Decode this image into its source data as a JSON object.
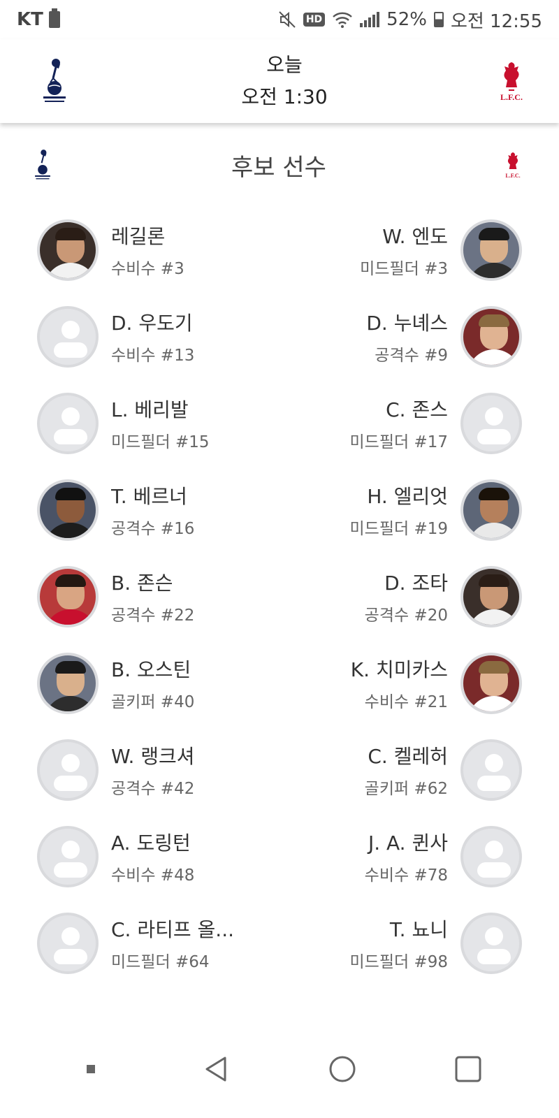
{
  "status_bar": {
    "carrier": "KT",
    "battery_percent": "52%",
    "time": "오전 12:55",
    "hd": "HD"
  },
  "match": {
    "day": "오늘",
    "time": "오전 1:30",
    "home_crest": "tottenham-crest",
    "away_crest": "liverpool-crest"
  },
  "section": {
    "title": "후보 선수"
  },
  "home_players": [
    {
      "name": "레길론",
      "position": "수비수 #3",
      "has_photo": true
    },
    {
      "name": "D. 우도기",
      "position": "수비수 #13",
      "has_photo": false
    },
    {
      "name": "L. 베리발",
      "position": "미드필더 #15",
      "has_photo": false
    },
    {
      "name": "T. 베르너",
      "position": "공격수 #16",
      "has_photo": true
    },
    {
      "name": "B. 존슨",
      "position": "공격수 #22",
      "has_photo": true
    },
    {
      "name": "B. 오스틴",
      "position": "골키퍼 #40",
      "has_photo": true
    },
    {
      "name": "W. 랭크셔",
      "position": "공격수 #42",
      "has_photo": false
    },
    {
      "name": "A. 도링턴",
      "position": "수비수 #48",
      "has_photo": false
    },
    {
      "name": "C. 라티프 올...",
      "position": "미드필더 #64",
      "has_photo": false
    }
  ],
  "away_players": [
    {
      "name": "W. 엔도",
      "position": "미드필더 #3",
      "has_photo": true
    },
    {
      "name": "D. 누녜스",
      "position": "공격수 #9",
      "has_photo": true
    },
    {
      "name": "C. 존스",
      "position": "미드필더 #17",
      "has_photo": false
    },
    {
      "name": "H. 엘리엇",
      "position": "미드필더 #19",
      "has_photo": true
    },
    {
      "name": "D. 조타",
      "position": "공격수 #20",
      "has_photo": true
    },
    {
      "name": "K. 치미카스",
      "position": "수비수 #21",
      "has_photo": true
    },
    {
      "name": "C. 켈레허",
      "position": "골키퍼 #62",
      "has_photo": false
    },
    {
      "name": "J. A. 퀸사",
      "position": "수비수 #78",
      "has_photo": false
    },
    {
      "name": "T. 뇨니",
      "position": "미드필더 #98",
      "has_photo": false
    }
  ],
  "colors": {
    "tottenham_navy": "#132257",
    "liverpool_red": "#c8102e",
    "placeholder_bg": "#e4e5e8"
  }
}
